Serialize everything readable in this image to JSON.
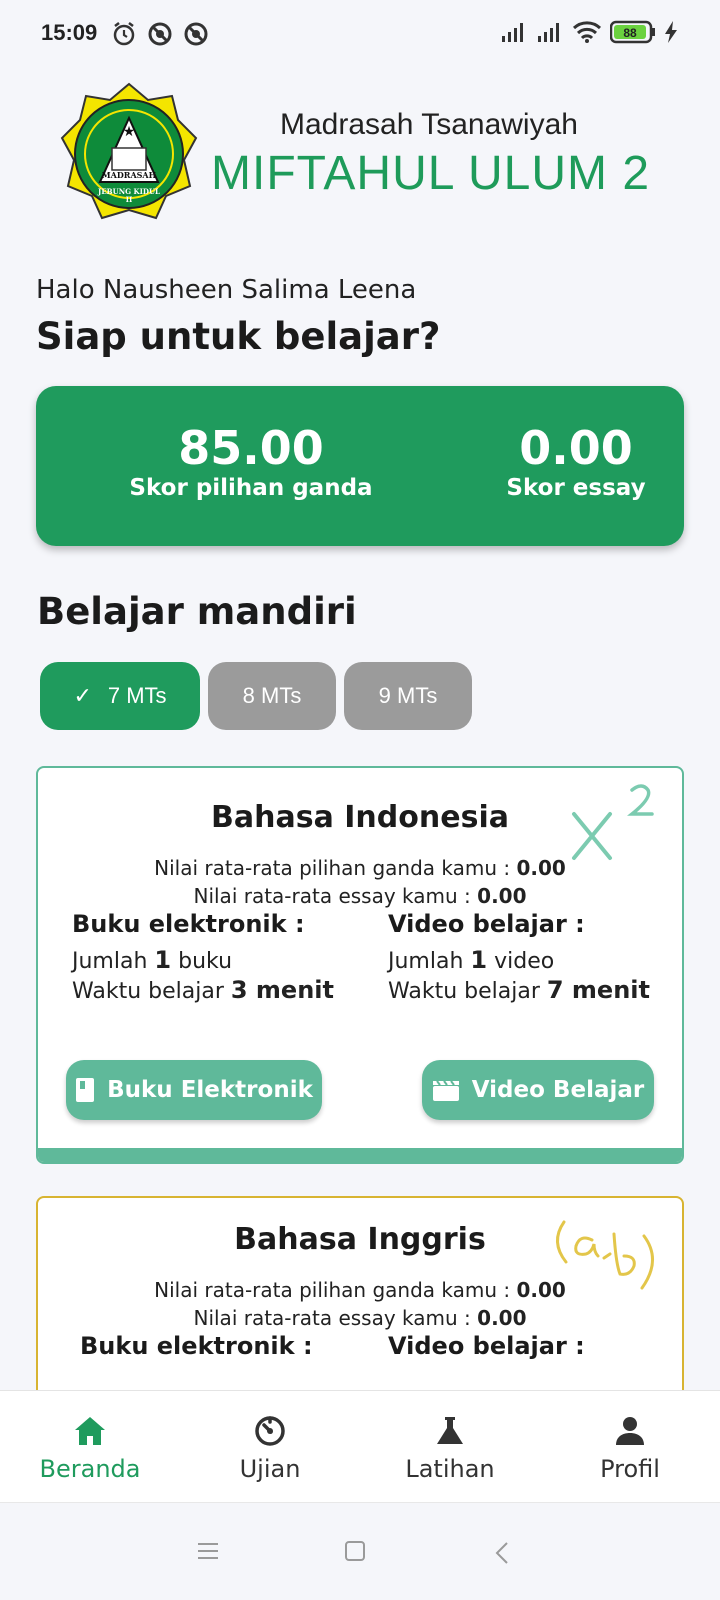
{
  "status": {
    "time": "15:09",
    "battery": "88",
    "icons": [
      "alarm-icon",
      "sync-off-icon",
      "sync-off-icon",
      "signal-icon",
      "signal-icon",
      "wifi-icon",
      "battery-icon",
      "charging-icon"
    ]
  },
  "header": {
    "subtitle": "Madrasah Tsanawiyah",
    "title": "MIFTAHUL ULUM 2",
    "logo_text": "MADRASAH",
    "logo_sub": "JEBUNG KIDUL",
    "logo_num": "II"
  },
  "greeting": "Halo Nausheen Salima Leena",
  "headline": "Siap untuk belajar?",
  "scores": {
    "multiple_choice_value": "85.00",
    "multiple_choice_label": "Skor pilihan ganda",
    "essay_value": "0.00",
    "essay_label": "Skor essay"
  },
  "section_title": "Belajar mandiri",
  "grades": [
    {
      "label": "7 MTs",
      "selected": true
    },
    {
      "label": "8 MTs",
      "selected": false
    },
    {
      "label": "9 MTs",
      "selected": false
    }
  ],
  "subjects": [
    {
      "name": "Bahasa Indonesia",
      "avg_mc_text": "Nilai rata-rata pilihan ganda kamu : ",
      "avg_mc": "0.00",
      "avg_essay_text": "Nilai rata-rata essay kamu : ",
      "avg_essay": "0.00",
      "ebook_title": "Buku elektronik :",
      "ebook_count_prefix": "Jumlah ",
      "ebook_count": "1",
      "ebook_count_suffix": " buku",
      "ebook_time_prefix": "Waktu belajar ",
      "ebook_time": "3 menit",
      "video_title": "Video belajar :",
      "video_count_prefix": "Jumlah ",
      "video_count": "1",
      "video_count_suffix": " video",
      "video_time_prefix": "Waktu belajar ",
      "video_time": "7 menit",
      "ebook_button": "Buku Elektronik",
      "video_button": "Video Belajar",
      "accent": "#5fb99a",
      "decoration": "x-squared-icon"
    },
    {
      "name": "Bahasa Inggris",
      "avg_mc_text": "Nilai rata-rata pilihan ganda kamu : ",
      "avg_mc": "0.00",
      "avg_essay_text": "Nilai rata-rata essay kamu : ",
      "avg_essay": "0.00",
      "ebook_title": "Buku elektronik :",
      "video_title": "Video belajar :",
      "accent": "#d8b431",
      "decoration": "ab-icon"
    }
  ],
  "nav": [
    {
      "label": "Beranda",
      "icon": "home-icon",
      "active": true
    },
    {
      "label": "Ujian",
      "icon": "timer-icon",
      "active": false
    },
    {
      "label": "Latihan",
      "icon": "flask-icon",
      "active": false
    },
    {
      "label": "Profil",
      "icon": "person-icon",
      "active": false
    }
  ],
  "colors": {
    "primary": "#1f9b5d",
    "secondary": "#5fb99a",
    "inactive": "#9b9b9b",
    "yellow_accent": "#d8b431"
  }
}
